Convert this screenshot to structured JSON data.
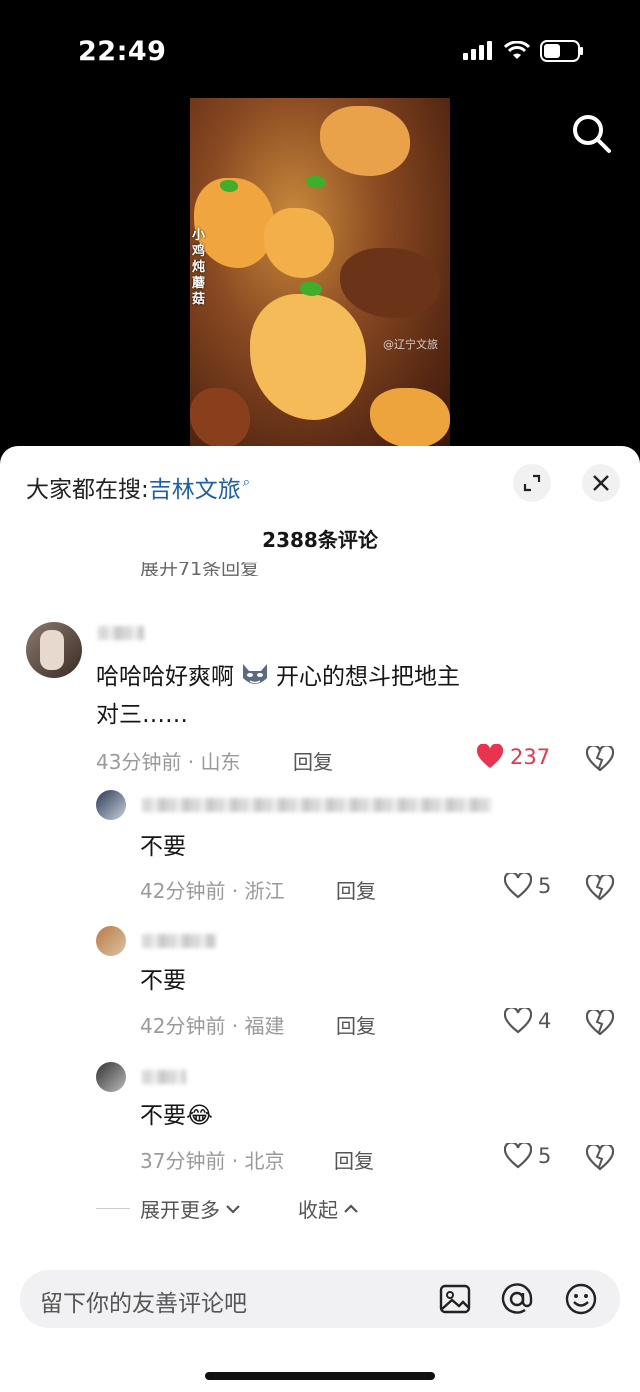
{
  "status": {
    "time": "22:49"
  },
  "video": {
    "caption": "小鸡炖蘑菇",
    "watermark": "@辽宁文旅"
  },
  "sheet": {
    "search_prefix": "大家都在搜:",
    "search_keyword": "吉林文旅",
    "comment_count": "2388条评论",
    "partial_expand": "展开71条回复"
  },
  "comments": [
    {
      "text": "哈哈哈好爽啊🐺 开心的想斗把地主对三……",
      "text_line1": "哈哈哈好爽啊",
      "text_line1b": "开心的想斗把地主",
      "text_line2": "对三……",
      "meta": "43分钟前 · 山东",
      "reply": "回复",
      "likes": "237",
      "liked": true
    }
  ],
  "replies": [
    {
      "text": "不要",
      "meta": "42分钟前 · 浙江",
      "reply": "回复",
      "likes": "5"
    },
    {
      "text": "不要",
      "meta": "42分钟前 · 福建",
      "reply": "回复",
      "likes": "4"
    },
    {
      "text": "不要😂",
      "meta": "37分钟前 · 北京",
      "reply": "回复",
      "likes": "5"
    }
  ],
  "expand": {
    "more": "展开更多",
    "collapse": "收起"
  },
  "input": {
    "placeholder": "留下你的友善评论吧"
  },
  "colors": {
    "like_red": "#e9334f",
    "link_blue": "#1f5fa8"
  },
  "icons": [
    "search-icon",
    "expand-icon",
    "close-icon",
    "heart-icon",
    "dislike-icon",
    "image-icon",
    "at-icon",
    "emoji-icon"
  ]
}
